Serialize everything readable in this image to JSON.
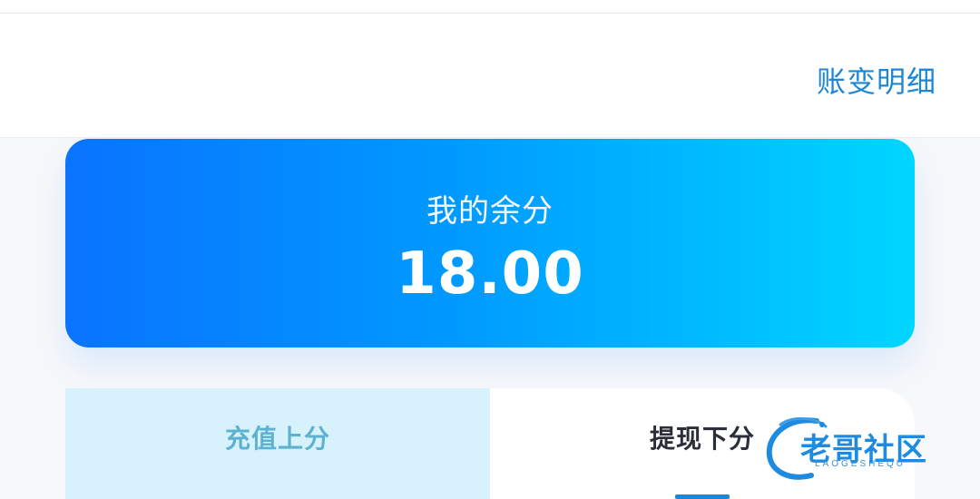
{
  "header": {
    "link_label": "账变明细"
  },
  "balance": {
    "label": "我的余分",
    "amount": "18.00"
  },
  "tabs": [
    {
      "label": "充值上分",
      "active": false
    },
    {
      "label": "提现下分",
      "active": true
    }
  ],
  "watermark": {
    "title": "老哥社区",
    "subtitle": "LAOGESHEQU"
  },
  "colors": {
    "accent": "#1f86d6",
    "card_gradient_start": "#0a73ff",
    "card_gradient_end": "#00d6ff",
    "inactive_tab_bg": "#d8f2fd",
    "inactive_tab_text": "#5db2d0"
  }
}
